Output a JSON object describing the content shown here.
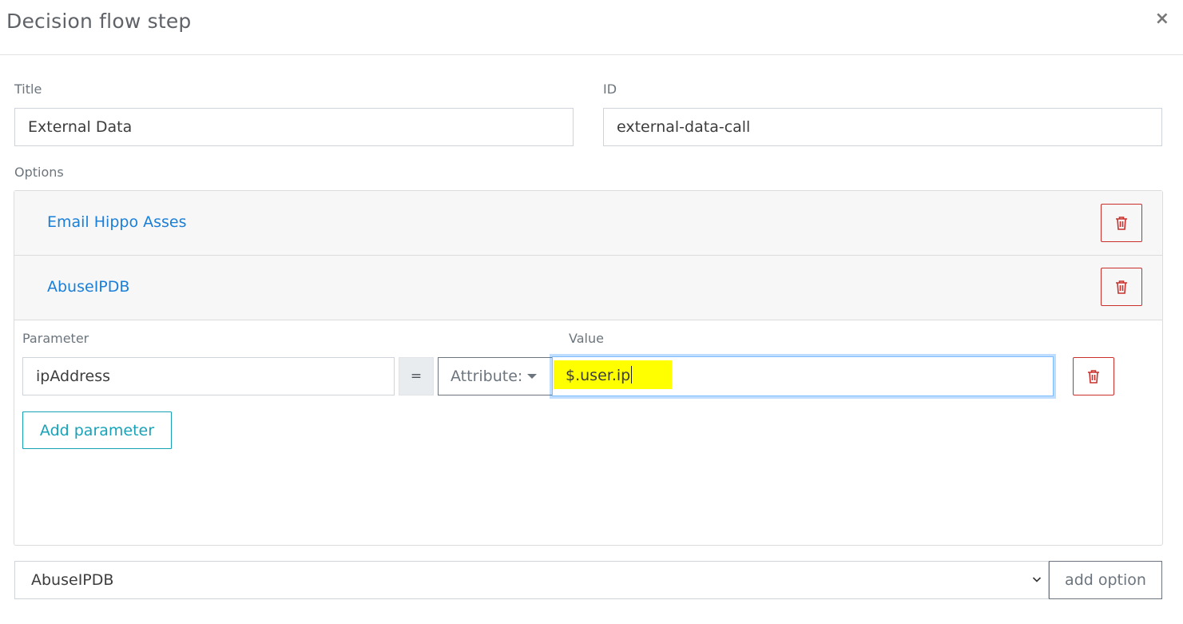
{
  "modal": {
    "title": "Decision flow step",
    "close_label": "×"
  },
  "fields": {
    "title_label": "Title",
    "title_value": "External Data",
    "id_label": "ID",
    "id_value": "external-data-call",
    "options_label": "Options"
  },
  "options": {
    "items": [
      {
        "label": "Email Hippo Asses"
      },
      {
        "label": "AbuseIPDB"
      }
    ]
  },
  "parameters": {
    "parameter_label": "Parameter",
    "value_label": "Value",
    "rows": [
      {
        "name": "ipAddress",
        "operator": "=",
        "type": "Attribute:",
        "value": "$.user.ip"
      }
    ],
    "add_label": "Add parameter"
  },
  "footer": {
    "select_value": "AbuseIPDB",
    "add_option_label": "add option"
  },
  "colors": {
    "link": "#1a7fd9",
    "danger": "#c9302c",
    "info": "#17a2b8",
    "highlight": "#ffff00",
    "focus": "#80bdff"
  },
  "icons": {
    "close": "close-icon",
    "trash": "trash-icon",
    "caret": "caret-down-icon",
    "chevron": "chevron-down-icon"
  }
}
